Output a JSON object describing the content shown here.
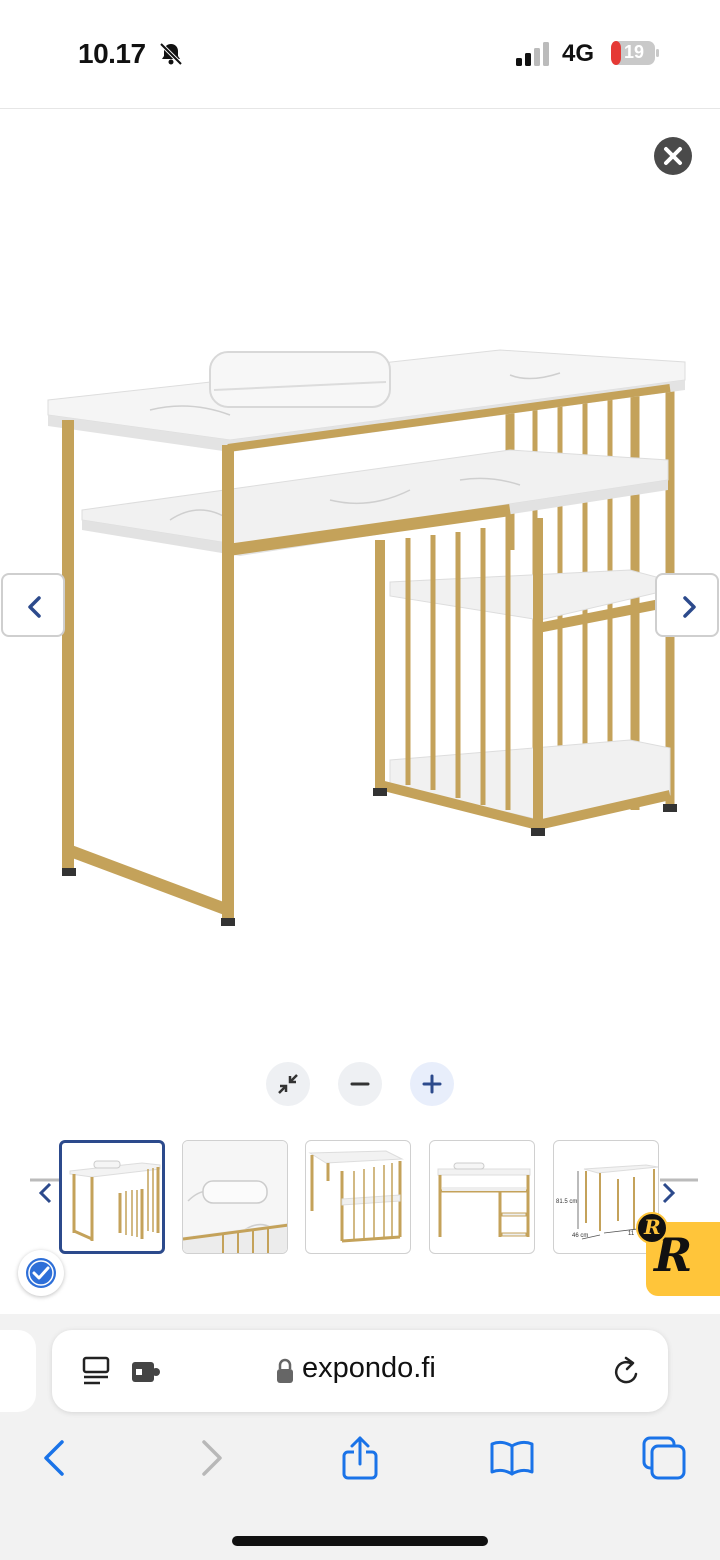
{
  "status_bar": {
    "time": "10.17",
    "network": "4G",
    "battery": "19"
  },
  "gallery": {
    "icons": {
      "close": "close-icon",
      "prev": "chevron-left-icon",
      "next": "chevron-right-icon",
      "zoom_fit": "collapse-icon",
      "zoom_out": "minus-icon",
      "zoom_in": "plus-icon"
    },
    "thumbnails": [
      {
        "label": "thumbnail-1"
      },
      {
        "label": "thumbnail-2"
      },
      {
        "label": "thumbnail-3"
      },
      {
        "label": "thumbnail-4"
      },
      {
        "label": "thumbnail-5",
        "dim_height": "81.5 cm",
        "dim_depth": "46 cm",
        "dim_width_partial": "11"
      }
    ]
  },
  "badges": {
    "r_letter": "R",
    "r_small_letter": "R"
  },
  "browser": {
    "url": "expondo.fi",
    "icons": [
      "reader-icon",
      "extension-icon",
      "lock-icon",
      "reload-icon",
      "back-icon",
      "forward-icon",
      "share-icon",
      "bookmarks-icon",
      "tabs-icon"
    ]
  },
  "colors": {
    "accent": "#2c4a8c",
    "ios_blue": "#1a73e8",
    "gold": "#c4a25a",
    "marble": "#f4f4f4"
  }
}
